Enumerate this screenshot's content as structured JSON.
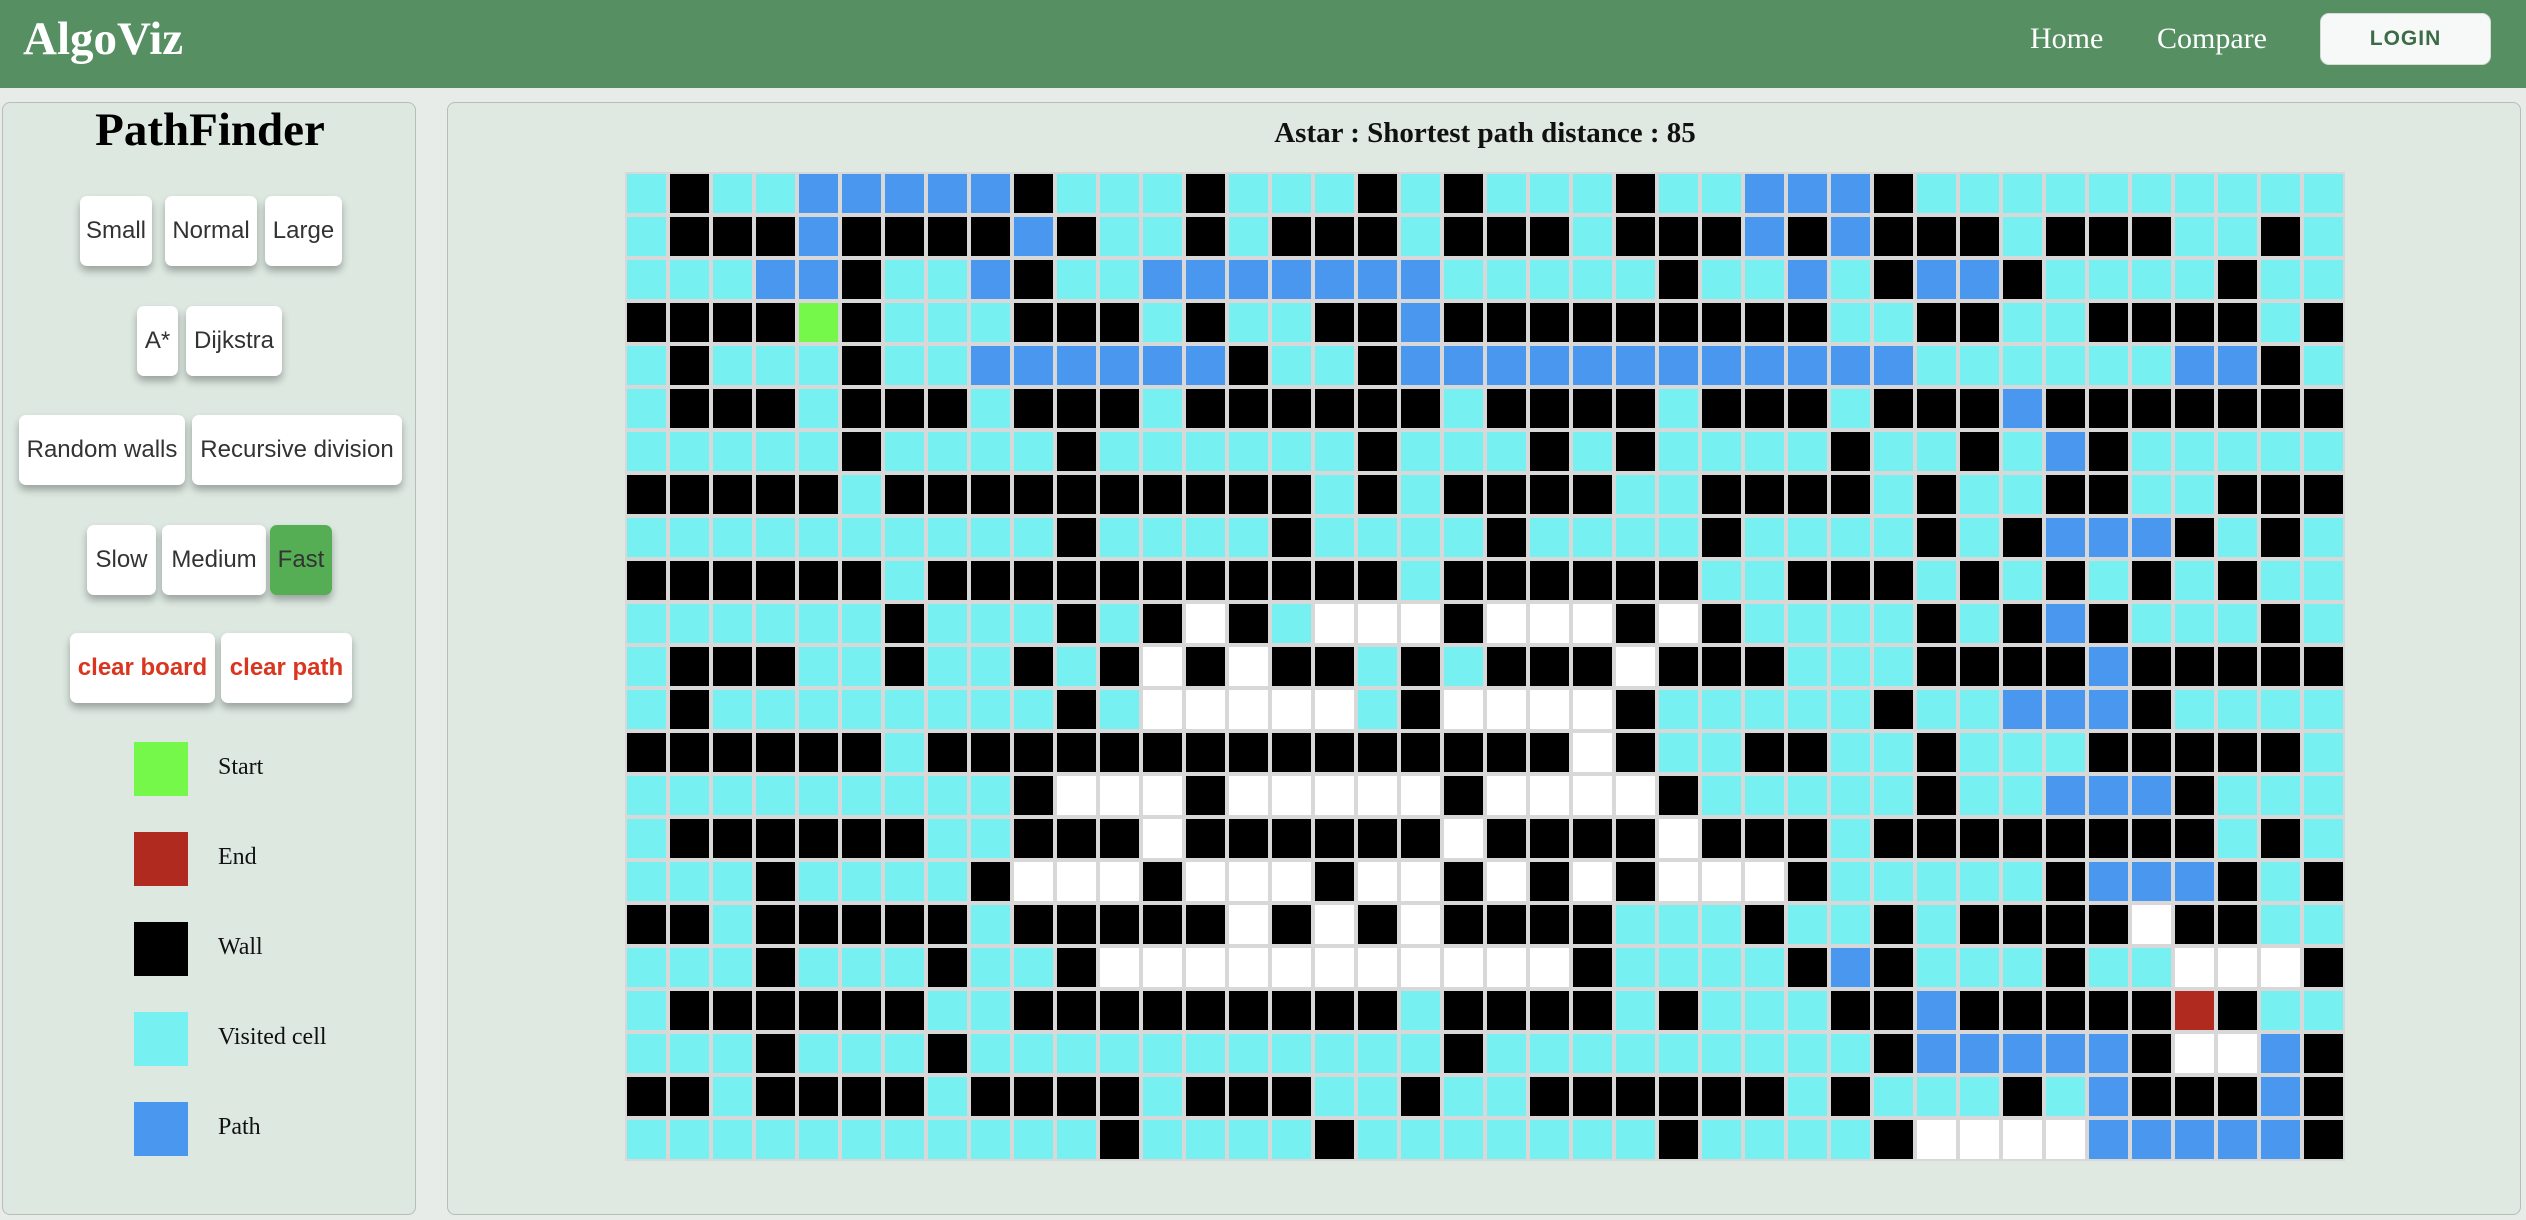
{
  "app": {
    "brand": "AlgoViz",
    "nav": {
      "home": "Home",
      "compare": "Compare",
      "login": "LOGIN"
    }
  },
  "sidebar": {
    "title": "PathFinder",
    "size_buttons": [
      "Small",
      "Normal",
      "Large"
    ],
    "algorithm_buttons": [
      "A*",
      "Dijkstra"
    ],
    "maze_buttons": [
      "Random walls",
      "Recursive division"
    ],
    "speed_buttons": [
      "Slow",
      "Medium",
      "Fast"
    ],
    "selected_speed": "Fast",
    "clear_buttons": [
      "clear board",
      "clear path"
    ],
    "legend": [
      {
        "label": "Start",
        "color": "#76f84a"
      },
      {
        "label": "End",
        "color": "#b02a1f"
      },
      {
        "label": "Wall",
        "color": "#000000"
      },
      {
        "label": "Visited cell",
        "color": "#76f0f0"
      },
      {
        "label": "Path",
        "color": "#4a97f0"
      }
    ]
  },
  "main": {
    "result_text": "Astar : Shortest path distance : 85"
  },
  "grid": {
    "rows": 23,
    "cols": 40,
    "cell_types": {
      ".": {
        "name": "unvisited",
        "color": "#ffffff"
      },
      "v": {
        "name": "visited",
        "color": "#76f0f0"
      },
      "#": {
        "name": "wall",
        "color": "#000000"
      },
      "p": {
        "name": "path",
        "color": "#4a97f0"
      },
      "S": {
        "name": "start",
        "color": "#76f84a"
      },
      "E": {
        "name": "end",
        "color": "#b02a1f"
      }
    },
    "cells": [
      "v#vvppppp#vvv#vvv#v#vvv#vvppp#vvvvvvvvvv",
      "v###p####p#vv#v###v###v###p#p###v###vv#",
      "vvvpp#vvp#vvpppppppvvvvv#vvpv#pp#vvvv#vvv",
      "####S#vvv###v#vv##p#########vv##vv####v###",
      "v#vvv#vvpppppp#vv#ppppppppppppvvvvvvpp#vvv",
      "v###v###v###v######v####v###v###p#######",
      "vvvvv#vvvv#vvvvvv#vvv#v#vvvv#vv#vp#vvvvv",
      "#####v##########v#v####vv####v#vv##vv###",
      "vvvvvvvvvv#vvvv#vvvv#vvvv#vvvv#v#ppp#v#vv",
      "######v###########v######vv###v#v#v#v#vv",
      "vvvvvv#vvv#v#.#v...#...#.#vvvv#v#p#vvv#vv",
      "v###vv#vv#v#.#.##v#v###.###vvv####p#######",
      "v#vvvvvvvv#v.....v#....#vvvvv#vvppp#vvvvvv",
      "######v###############.#vv##vv#vvv#####v#vv",
      "vvvvvvvvv#...#.....#....#vvvvv#vvppp#vvv#vv",
      "v######vv###.######.####.###v########v#vv",
      "vvv#vvvv#...#...#..#.#.#...#vvvvv#ppp#v#...#vv",
      "##v#####v#####.#.#.####vvv#vv#v####.##vvv",
      "vvv#vvv#vv#...........#vvvv#p#vvv#vv...#vv",
      "v######vv#########v####v#vvv##p#####E#vv",
      "vvv#vvv#vvvvvvvvvvv#vvvvvvvvv#ppppp#..p#vv",
      "##v####v####v###vv#vv######v#vvv#vp###p#vv",
      "vvvvvvvvvvv#vvvv#vvvvvvv#vvvv#....ppppp#vvv"
    ]
  }
}
